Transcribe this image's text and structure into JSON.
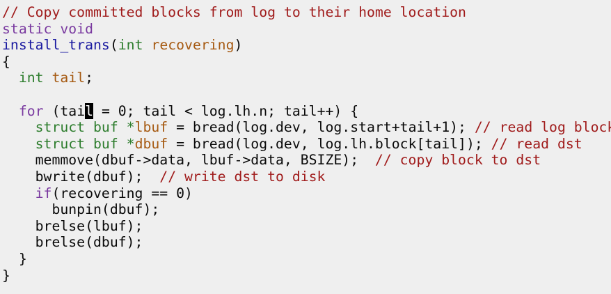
{
  "code": {
    "lines": [
      [
        {
          "t": "// Copy committed blocks from log to their home location",
          "c": "comment"
        }
      ],
      [
        {
          "t": "static void",
          "c": "kw"
        }
      ],
      [
        {
          "t": "install_trans",
          "c": "fn"
        },
        {
          "t": "(",
          "c": ""
        },
        {
          "t": "int",
          "c": "ty"
        },
        {
          "t": " ",
          "c": ""
        },
        {
          "t": "recovering",
          "c": "var"
        },
        {
          "t": ")",
          "c": ""
        }
      ],
      [
        {
          "t": "{",
          "c": ""
        }
      ],
      [
        {
          "t": "  ",
          "c": ""
        },
        {
          "t": "int",
          "c": "ty"
        },
        {
          "t": " ",
          "c": ""
        },
        {
          "t": "tail",
          "c": "var"
        },
        {
          "t": ";",
          "c": ""
        }
      ],
      [
        {
          "t": "",
          "c": ""
        }
      ],
      [
        {
          "t": "  ",
          "c": ""
        },
        {
          "t": "for",
          "c": "kw"
        },
        {
          "t": " (tai",
          "c": ""
        },
        {
          "t": "l",
          "c": "cursor"
        },
        {
          "t": " = 0; tail < log.lh.n; tail++) {",
          "c": ""
        }
      ],
      [
        {
          "t": "    ",
          "c": ""
        },
        {
          "t": "struct buf *",
          "c": "ty"
        },
        {
          "t": "lbuf",
          "c": "var"
        },
        {
          "t": " = bread(log.dev, log.start+tail+1); ",
          "c": ""
        },
        {
          "t": "// read log block",
          "c": "comment"
        }
      ],
      [
        {
          "t": "    ",
          "c": ""
        },
        {
          "t": "struct buf *",
          "c": "ty"
        },
        {
          "t": "dbuf",
          "c": "var"
        },
        {
          "t": " = bread(log.dev, log.lh.block[tail]); ",
          "c": ""
        },
        {
          "t": "// read dst",
          "c": "comment"
        }
      ],
      [
        {
          "t": "    memmove(dbuf->data, lbuf->data, BSIZE);  ",
          "c": ""
        },
        {
          "t": "// copy block to dst",
          "c": "comment"
        }
      ],
      [
        {
          "t": "    bwrite(dbuf);  ",
          "c": ""
        },
        {
          "t": "// write dst to disk",
          "c": "comment"
        }
      ],
      [
        {
          "t": "    ",
          "c": ""
        },
        {
          "t": "if",
          "c": "kw"
        },
        {
          "t": "(recovering == 0)",
          "c": ""
        }
      ],
      [
        {
          "t": "      bunpin(dbuf);",
          "c": ""
        }
      ],
      [
        {
          "t": "    brelse(lbuf);",
          "c": ""
        }
      ],
      [
        {
          "t": "    brelse(dbuf);",
          "c": ""
        }
      ],
      [
        {
          "t": "  }",
          "c": ""
        }
      ],
      [
        {
          "t": "}",
          "c": ""
        }
      ]
    ]
  }
}
